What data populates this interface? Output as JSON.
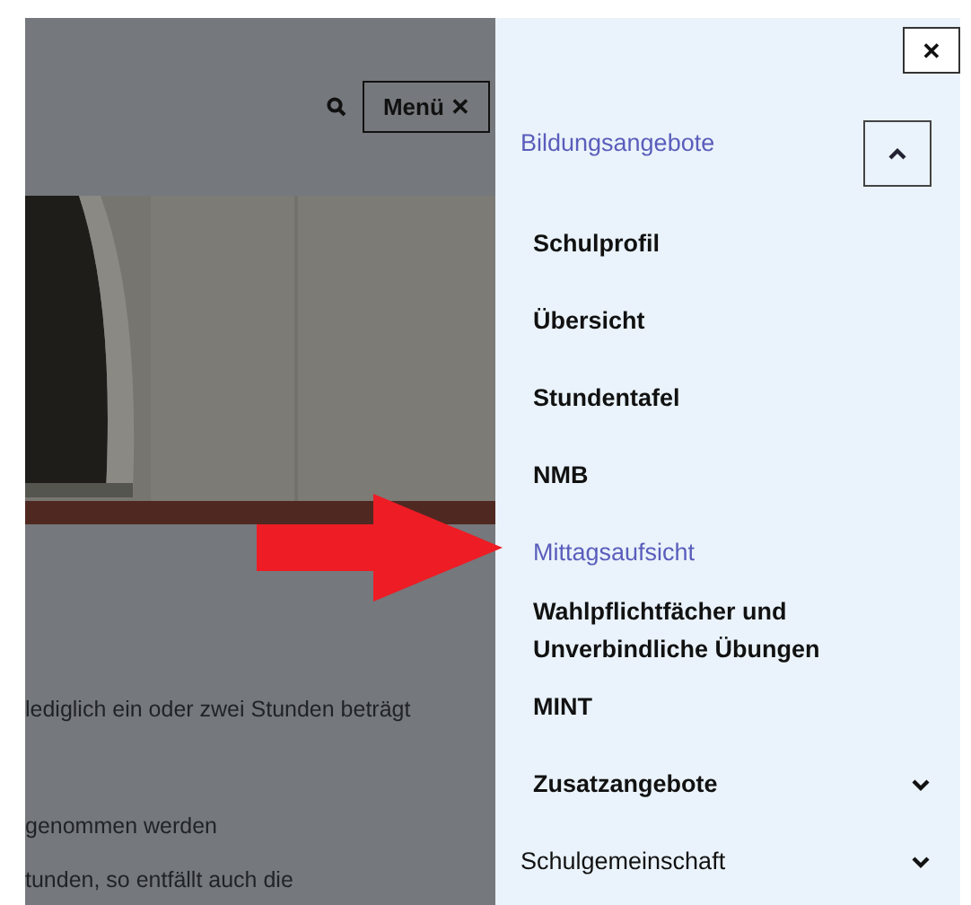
{
  "header": {
    "menu_button": "Menü ✕"
  },
  "page": {
    "text_lines": [
      "lediglich ein oder zwei Stunden beträgt",
      "genommen werden",
      "tunden, so entfällt auch die"
    ]
  },
  "menu": {
    "close": "✕",
    "sections": [
      {
        "label": "Bildungsangebote",
        "selected": true,
        "expanded": true,
        "children": [
          {
            "label": "Schulprofil",
            "selected": false
          },
          {
            "label": "Übersicht",
            "selected": false
          },
          {
            "label": "Stundentafel",
            "selected": false
          },
          {
            "label": "NMB",
            "selected": false
          },
          {
            "label": "Mittagsaufsicht",
            "selected": true
          },
          {
            "label": "Wahlpflichtfächer und Unverbindliche Übungen",
            "selected": false
          },
          {
            "label": "MINT",
            "selected": false
          },
          {
            "label": "Zusatzangebote",
            "selected": false,
            "expandable": true
          }
        ]
      },
      {
        "label": "Schulgemeinschaft",
        "selected": false,
        "expanded": false
      }
    ]
  }
}
